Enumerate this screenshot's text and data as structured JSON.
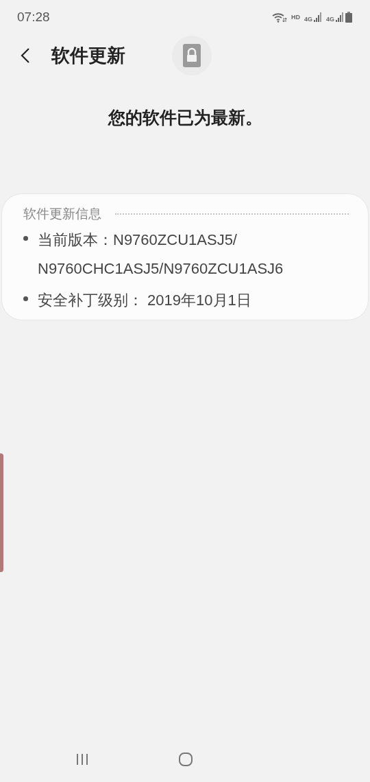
{
  "status_bar": {
    "time": "07:28",
    "network_labels": [
      "HD",
      "4G",
      "4G"
    ]
  },
  "header": {
    "title": "软件更新"
  },
  "message": "您的软件已为最新。",
  "info_card": {
    "title": "软件更新信息",
    "items": [
      "当前版本：N9760ZCU1ASJ5/ N9760CHC1ASJ5/N9760ZCU1ASJ6",
      "安全补丁级别： 2019年10月1日"
    ]
  }
}
